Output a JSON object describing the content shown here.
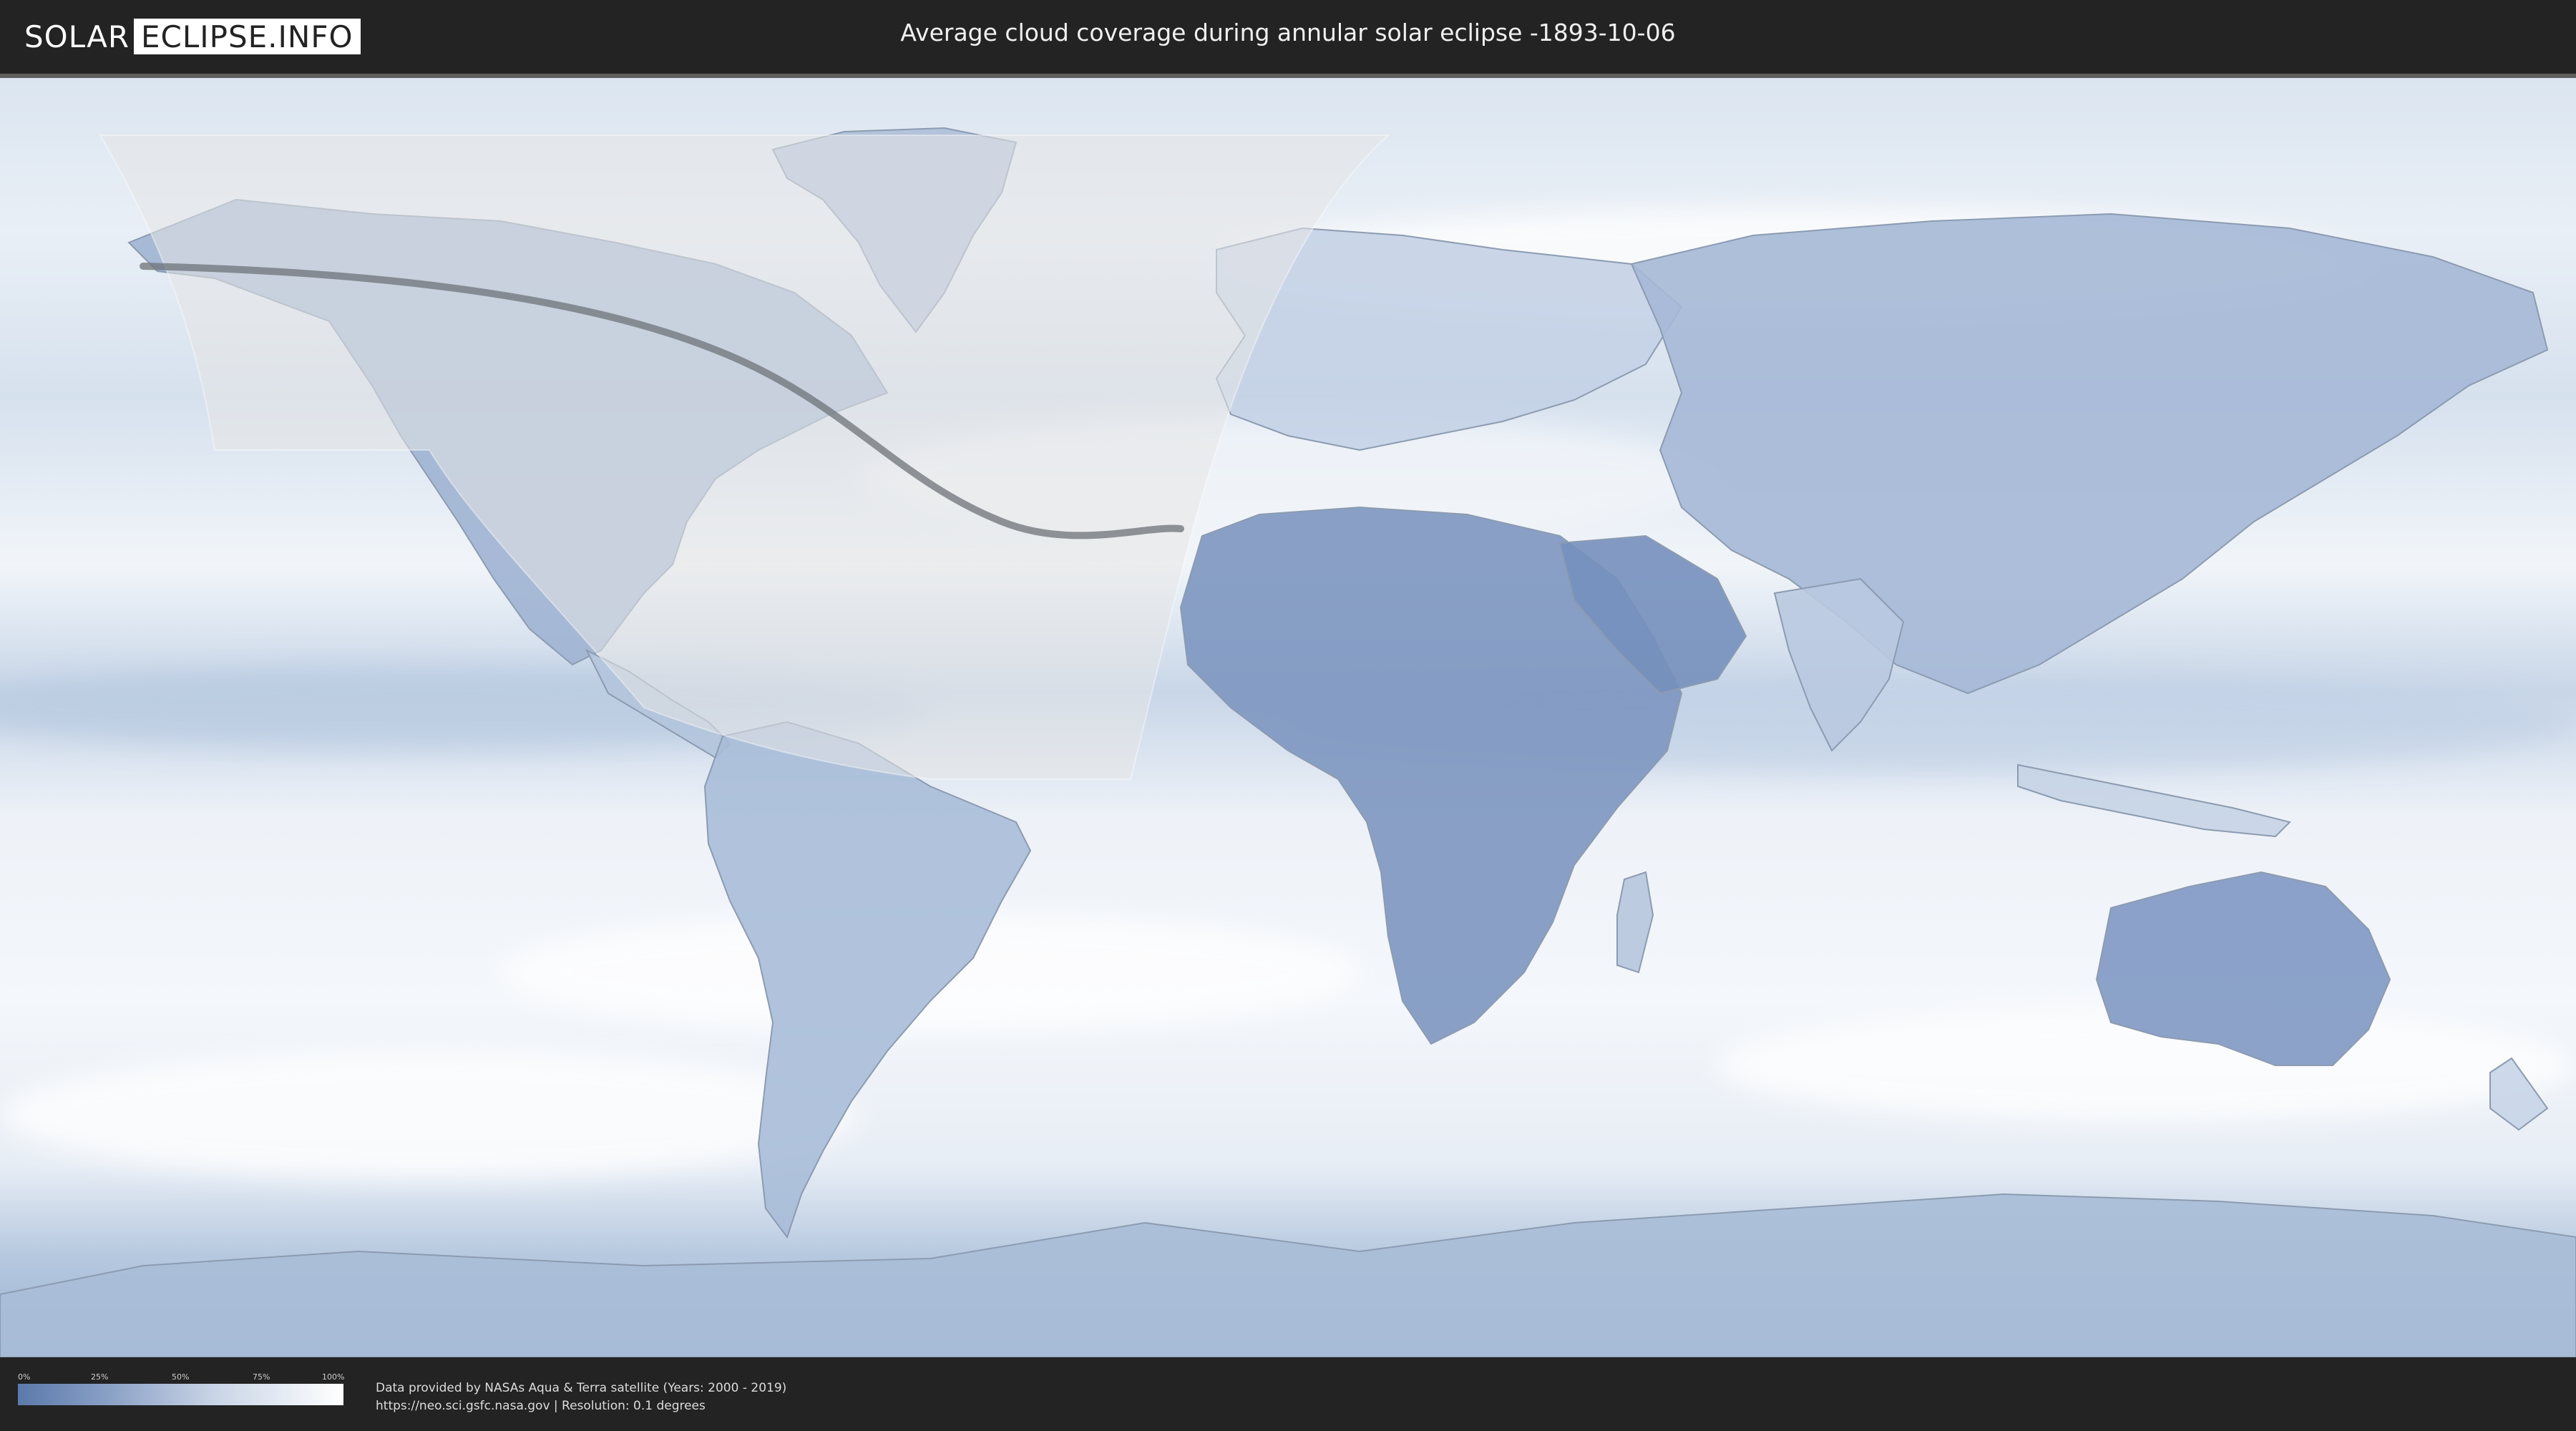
{
  "header": {
    "logo_left": "SOLAR",
    "logo_right": "ECLIPSE.INFO",
    "title": "Average cloud coverage during annular solar eclipse -1893-10-06"
  },
  "map": {
    "layer": "average cloud coverage",
    "eclipse_type": "annular",
    "colors": {
      "clear_sky": "#5b79ab",
      "full_cloud": "#ffffff",
      "eclipse_shadow": "#e6e6e6",
      "central_path": "#6e7378"
    }
  },
  "legend": {
    "ticks": [
      "0%",
      "25%",
      "50%",
      "75%",
      "100%"
    ]
  },
  "footer": {
    "source_line1": "Data provided by NASAs Aqua & Terra satellite (Years: 2000 - 2019)",
    "source_line2": "https://neo.sci.gsfc.nasa.gov | Resolution: 0.1 degrees"
  }
}
